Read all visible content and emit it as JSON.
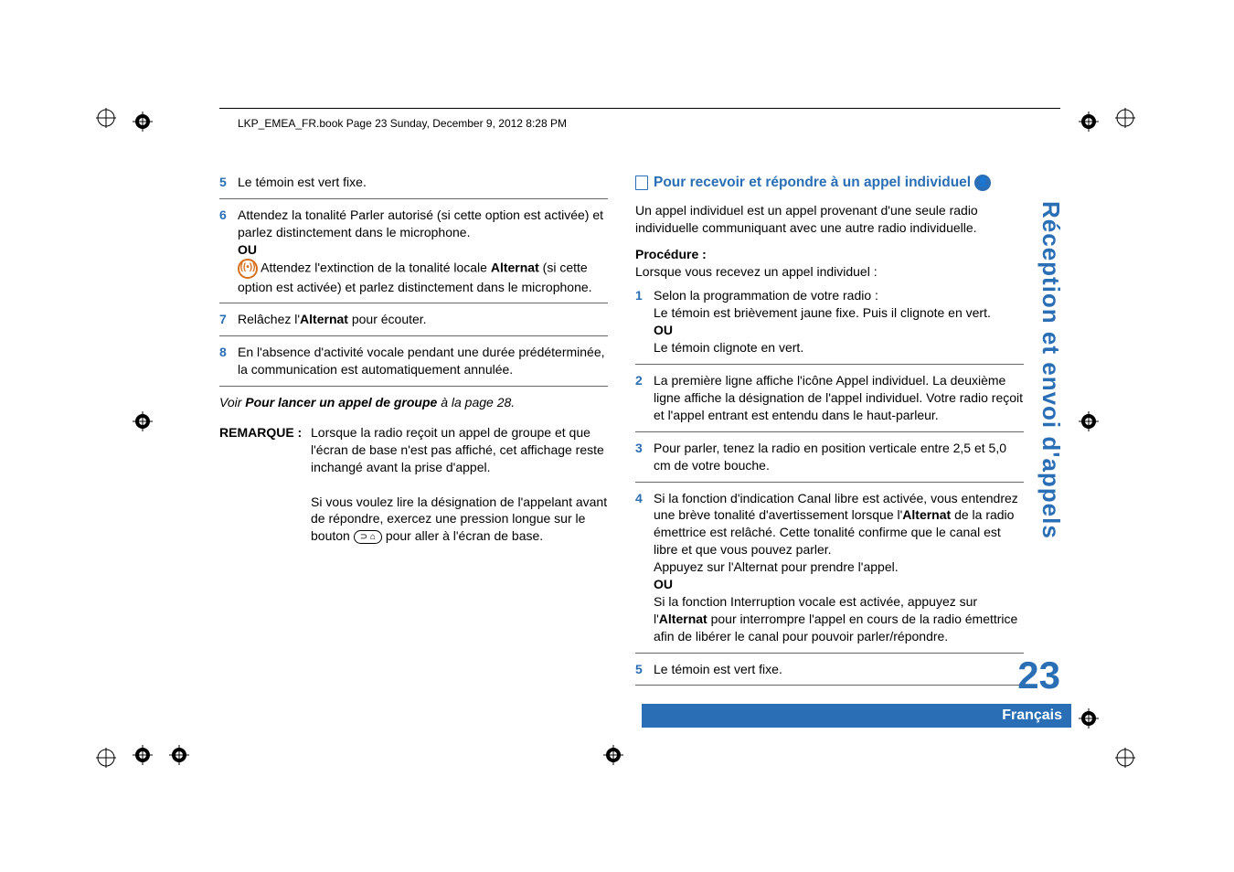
{
  "header": "LKP_EMEA_FR.book  Page 23  Sunday, December 9, 2012  8:28 PM",
  "side_title": "Réception et envoi d'appels",
  "page_number": "23",
  "language": "Français",
  "left": {
    "s5": "Le témoin est vert fixe.",
    "s6a": "Attendez la tonalité Parler autorisé (si cette option est activée) et parlez distinctement dans le microphone.",
    "ou": "OU",
    "s6b_pre": " Attendez l'extinction de la tonalité locale ",
    "s6b_bold": "Alternat",
    "s6b_post": " (si cette option est activée) et parlez distinctement dans le microphone.",
    "s7_pre": "Relâchez l'",
    "s7_bold": "Alternat",
    "s7_post": " pour écouter.",
    "s8": "En l'absence d'activité vocale pendant une durée prédéterminée, la communication est automatiquement annulée.",
    "ref_pre": "Voir ",
    "ref_bold": "Pour lancer un appel de groupe",
    "ref_post": " à la page 28.",
    "remarque_label": "REMARQUE :",
    "remarque1": "Lorsque la radio reçoit un appel de groupe et que l'écran de base n'est pas affiché, cet affichage reste inchangé avant la prise d'appel.",
    "remarque2_a": "Si vous voulez lire la désignation de l'appelant avant de répondre, exercez une pression longue sur le bouton ",
    "remarque2_b": " pour aller à l'écran de base.",
    "btn_label": "⌂"
  },
  "right": {
    "heading": "Pour recevoir et répondre à un appel individuel",
    "intro": "Un appel individuel est un appel provenant d'une seule radio individuelle communiquant avec une autre radio individuelle.",
    "procedure_label": "Procédure :",
    "procedure_sub": "Lorsque vous recevez un appel individuel :",
    "s1a": "Selon la programmation de votre radio :",
    "s1b": "Le témoin est brièvement jaune fixe. Puis il clignote en vert.",
    "ou": "OU",
    "s1c": "Le témoin clignote en vert.",
    "s2": "La première ligne affiche l'icône Appel individuel. La deuxième ligne affiche la désignation de l'appel individuel. Votre radio reçoit et l'appel entrant est entendu dans le haut-parleur.",
    "s3": "Pour parler, tenez la radio en position verticale entre 2,5 et 5,0 cm de votre bouche.",
    "s4a": "Si la fonction d'indication Canal libre est activée, vous entendrez une brève tonalité d'avertissement lorsque l'",
    "s4a_bold": "Alternat",
    "s4a2": " de la radio émettrice est relâché. Cette tonalité confirme que le canal est libre et que vous pouvez parler.",
    "s4b": "Appuyez sur l'Alternat pour prendre l'appel.",
    "s4c_pre": "Si la fonction Interruption vocale est activée, appuyez sur l'",
    "s4c_bold": "Alternat",
    "s4c_post": " pour interrompre l'appel en cours de la radio émettrice afin de libérer le canal pour pouvoir parler/répondre.",
    "s5": "Le témoin est vert fixe."
  }
}
